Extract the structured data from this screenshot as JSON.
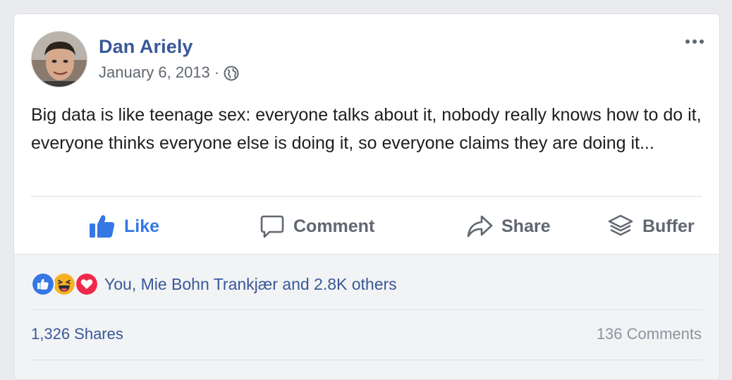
{
  "post": {
    "author": "Dan Ariely",
    "date": "January 6, 2013",
    "separator": "·",
    "privacy_icon": "globe-icon",
    "text": "Big data is like teenage sex: everyone talks about it, nobody really knows how to do it, everyone thinks everyone else is doing it, so everyone claims they are doing it..."
  },
  "actions": {
    "like": "Like",
    "comment": "Comment",
    "share": "Share",
    "buffer": "Buffer"
  },
  "reactions": {
    "icons": [
      "like-reaction-icon",
      "haha-reaction-icon",
      "love-reaction-icon"
    ],
    "summary": "You, Mie Bohn Trankjær and 2.8K others"
  },
  "stats": {
    "shares": "1,326 Shares",
    "comments": "136 Comments"
  },
  "colors": {
    "link": "#385898",
    "like_blue": "#3578e5",
    "muted": "#606770",
    "love_red": "#f0284a",
    "haha_yellow": "#f7b125"
  }
}
